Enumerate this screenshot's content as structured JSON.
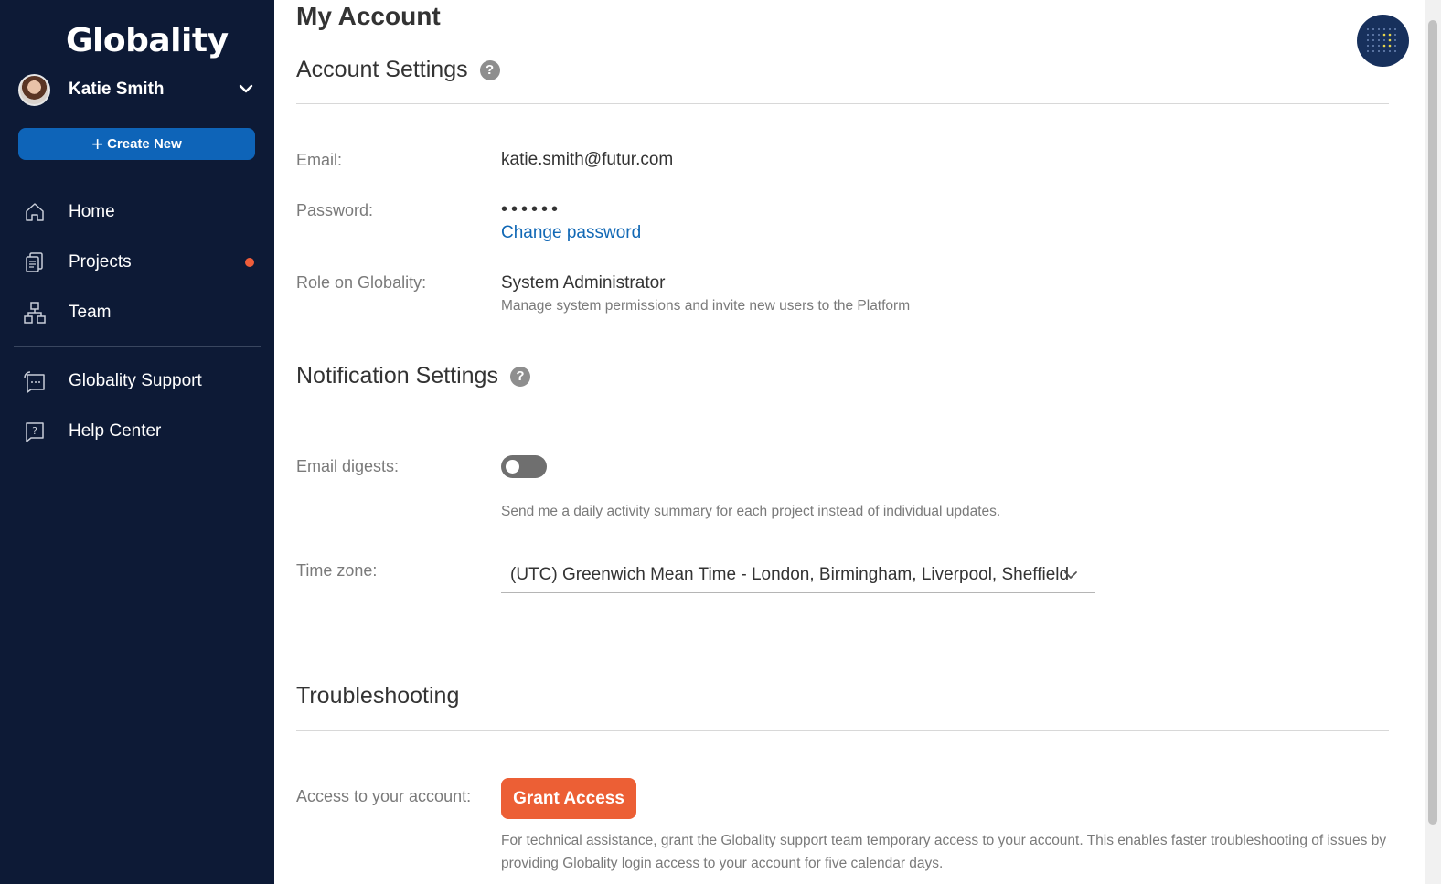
{
  "sidebar": {
    "logo": "Globality",
    "user_name": "Katie Smith",
    "create_label": "Create New",
    "nav": [
      {
        "label": "Home",
        "icon": "home-icon"
      },
      {
        "label": "Projects",
        "icon": "projects-icon",
        "has_notification": true
      },
      {
        "label": "Team",
        "icon": "team-icon"
      }
    ],
    "secondary_nav": [
      {
        "label": "Globality Support",
        "icon": "support-chat-icon"
      },
      {
        "label": "Help Center",
        "icon": "help-center-icon"
      }
    ],
    "background": "#0d1a36",
    "accent": "#0e64b8",
    "notification_color": "#ee5d3a"
  },
  "page": {
    "title": "My Account"
  },
  "account_settings": {
    "title": "Account Settings",
    "email_label": "Email:",
    "email_value": "katie.smith@futur.com",
    "password_label": "Password:",
    "password_mask": "••••••",
    "change_password": "Change password",
    "role_label": "Role on Globality:",
    "role_value": "System Administrator",
    "role_note": "Manage system permissions and invite new users to the Platform"
  },
  "notification_settings": {
    "title": "Notification Settings",
    "digests_label": "Email digests:",
    "digests_enabled": false,
    "digests_note": "Send me a daily activity summary for each project instead of individual updates.",
    "timezone_label": "Time zone:",
    "timezone_value": "(UTC) Greenwich Mean Time - London, Birmingham, Liverpool, Sheffield"
  },
  "troubleshooting": {
    "title": "Troubleshooting",
    "access_label": "Access to your account:",
    "grant_label": "Grant Access",
    "grant_color": "#ec5f35",
    "description": "For technical assistance, grant the Globality support team temporary access to your account. This enables faster troubleshooting of issues by providing Globality login access to your account for five calendar days."
  }
}
